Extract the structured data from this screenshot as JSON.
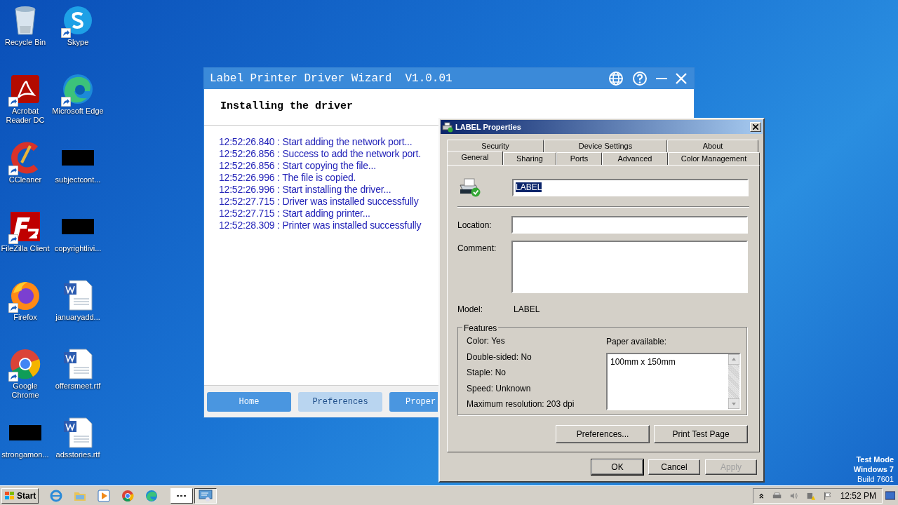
{
  "desktop_icons": [
    {
      "label": "Recycle Bin",
      "kind": "recycle",
      "shortcut": false
    },
    {
      "label": "Skype",
      "kind": "skype",
      "shortcut": true
    },
    {
      "label": "Acrobat Reader DC",
      "kind": "acrobat",
      "shortcut": true
    },
    {
      "label": "Microsoft Edge",
      "kind": "edge",
      "shortcut": true
    },
    {
      "label": "CCleaner",
      "kind": "ccleaner",
      "shortcut": true
    },
    {
      "label": "subjectcont...",
      "kind": "blank",
      "shortcut": false
    },
    {
      "label": "FileZilla Client",
      "kind": "filezilla",
      "shortcut": true
    },
    {
      "label": "copyrightlivi...",
      "kind": "blank",
      "shortcut": false
    },
    {
      "label": "Firefox",
      "kind": "firefox",
      "shortcut": true
    },
    {
      "label": "januaryadd...",
      "kind": "word",
      "shortcut": false
    },
    {
      "label": "Google Chrome",
      "kind": "chrome",
      "shortcut": true
    },
    {
      "label": "offersmeet.rtf",
      "kind": "word",
      "shortcut": false
    },
    {
      "label": "strongamon...",
      "kind": "blank",
      "shortcut": false
    },
    {
      "label": "adsstories.rtf",
      "kind": "word",
      "shortcut": false
    }
  ],
  "wizard": {
    "title": "Label Printer Driver Wizard  V1.0.01",
    "heading": "Installing the driver",
    "log": [
      "12:52:26.840 : Start adding the network port...",
      "12:52:26.856 : Success to add the network port.",
      "12:52:26.856 : Start copying the file...",
      "12:52:26.996 : The file is copied.",
      "12:52:26.996 : Start installing the driver...",
      "12:52:27.715 : Driver was installed successfully",
      "12:52:27.715 : Start adding printer...",
      "12:52:28.309 : Printer was installed successfully"
    ],
    "buttons": [
      {
        "label": "Home",
        "selected": false
      },
      {
        "label": "Preferences",
        "selected": true
      },
      {
        "label": "Proper",
        "selected": false
      }
    ]
  },
  "properties": {
    "title": "LABEL Properties",
    "tabs_back": [
      "Security",
      "Device Settings",
      "About"
    ],
    "tabs_front": [
      {
        "label": "General",
        "selected": true
      },
      {
        "label": "Sharing",
        "selected": false
      },
      {
        "label": "Ports",
        "selected": false
      },
      {
        "label": "Advanced",
        "selected": false
      },
      {
        "label": "Color Management",
        "selected": false
      }
    ],
    "name_value": "LABEL",
    "location_label": "Location:",
    "comment_label": "Comment:",
    "model_label": "Model:",
    "model_value": "LABEL",
    "features_legend": "Features",
    "features": [
      "Color: Yes",
      "Double-sided: No",
      "Staple: No",
      "Speed: Unknown",
      "Maximum resolution: 203 dpi"
    ],
    "paper_label": "Paper available:",
    "paper": [
      "100mm x 150mm"
    ],
    "panel_buttons": [
      "Preferences...",
      "Print Test Page"
    ],
    "dialog_buttons": [
      {
        "label": "OK",
        "disabled": false
      },
      {
        "label": "Cancel",
        "disabled": false
      },
      {
        "label": "Apply",
        "disabled": true
      }
    ]
  },
  "taskbar": {
    "start": "Start",
    "pinned": [
      {
        "kind": "ie"
      },
      {
        "kind": "explorer"
      },
      {
        "kind": "media"
      },
      {
        "kind": "chrome"
      },
      {
        "kind": "edge"
      }
    ],
    "tasks": [
      {
        "kind": "dots",
        "selected": false
      },
      {
        "kind": "wizard",
        "selected": true
      }
    ],
    "clock": "12:52 PM"
  },
  "test_mode": [
    "Test Mode",
    "Windows 7",
    "Build 7601"
  ]
}
